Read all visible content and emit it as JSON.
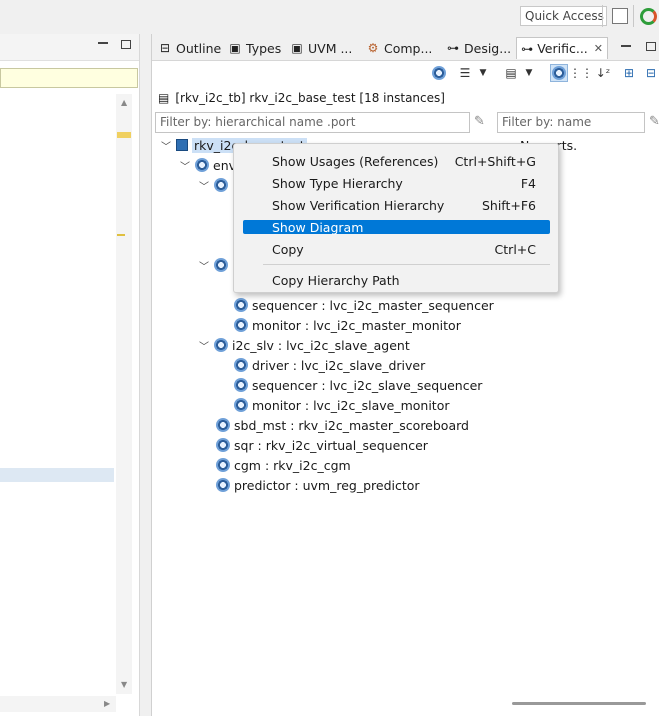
{
  "toolbar": {
    "quick_access": "Quick Access"
  },
  "tabs": [
    {
      "label": "Outline",
      "icon": "outline-icon"
    },
    {
      "label": "Types",
      "icon": "types-icon"
    },
    {
      "label": "UVM ...",
      "icon": "uvm-icon"
    },
    {
      "label": "Comp...",
      "icon": "components-icon"
    },
    {
      "label": "Desig...",
      "icon": "design-icon"
    },
    {
      "label": "Verific...",
      "icon": "verification-icon",
      "active": true
    }
  ],
  "header": {
    "instances": "[rkv_i2c_tb] rkv_i2c_base_test [18 instances]"
  },
  "filters": {
    "hier_placeholder": "Filter by: hierarchical name .port",
    "name_placeholder": "Filter by: name"
  },
  "no_ports": "No ports.",
  "tree": [
    {
      "text": "rkv_i2c_base_test",
      "level": 0,
      "expanded": true
    },
    {
      "text": "env",
      "level": 1,
      "expanded": true
    },
    {
      "text": "",
      "level": 2,
      "expanded": true
    },
    {
      "text": "",
      "level": 2,
      "expanded": true
    },
    {
      "text": "sequencer : lvc_i2c_master_sequencer",
      "level": 3
    },
    {
      "text": "monitor : lvc_i2c_master_monitor",
      "level": 3
    },
    {
      "text": "i2c_slv : lvc_i2c_slave_agent",
      "level": 2,
      "expanded": true
    },
    {
      "text": "driver : lvc_i2c_slave_driver",
      "level": 3
    },
    {
      "text": "sequencer : lvc_i2c_slave_sequencer",
      "level": 3
    },
    {
      "text": "monitor : lvc_i2c_slave_monitor",
      "level": 3
    },
    {
      "text": "sbd_mst : rkv_i2c_master_scoreboard",
      "level": 2
    },
    {
      "text": "sqr : rkv_i2c_virtual_sequencer",
      "level": 2
    },
    {
      "text": "cgm : rkv_i2c_cgm",
      "level": 2
    },
    {
      "text": "predictor : uvm_reg_predictor",
      "level": 2
    }
  ],
  "context_menu": {
    "items": [
      {
        "label": "Show Usages (References)",
        "shortcut": "Ctrl+Shift+G"
      },
      {
        "label": "Show Type Hierarchy",
        "shortcut": "F4"
      },
      {
        "label": "Show Verification Hierarchy",
        "shortcut": "Shift+F6"
      },
      {
        "label": "Show Diagram",
        "shortcut": "",
        "highlighted": true
      },
      {
        "label": "Copy",
        "shortcut": "Ctrl+C"
      },
      {
        "label": "Copy Hierarchy Path",
        "shortcut": ""
      }
    ]
  },
  "colors": {
    "accent": "#0078d7",
    "selection": "#cce0f6",
    "filter_bg": "#ffffe0"
  }
}
